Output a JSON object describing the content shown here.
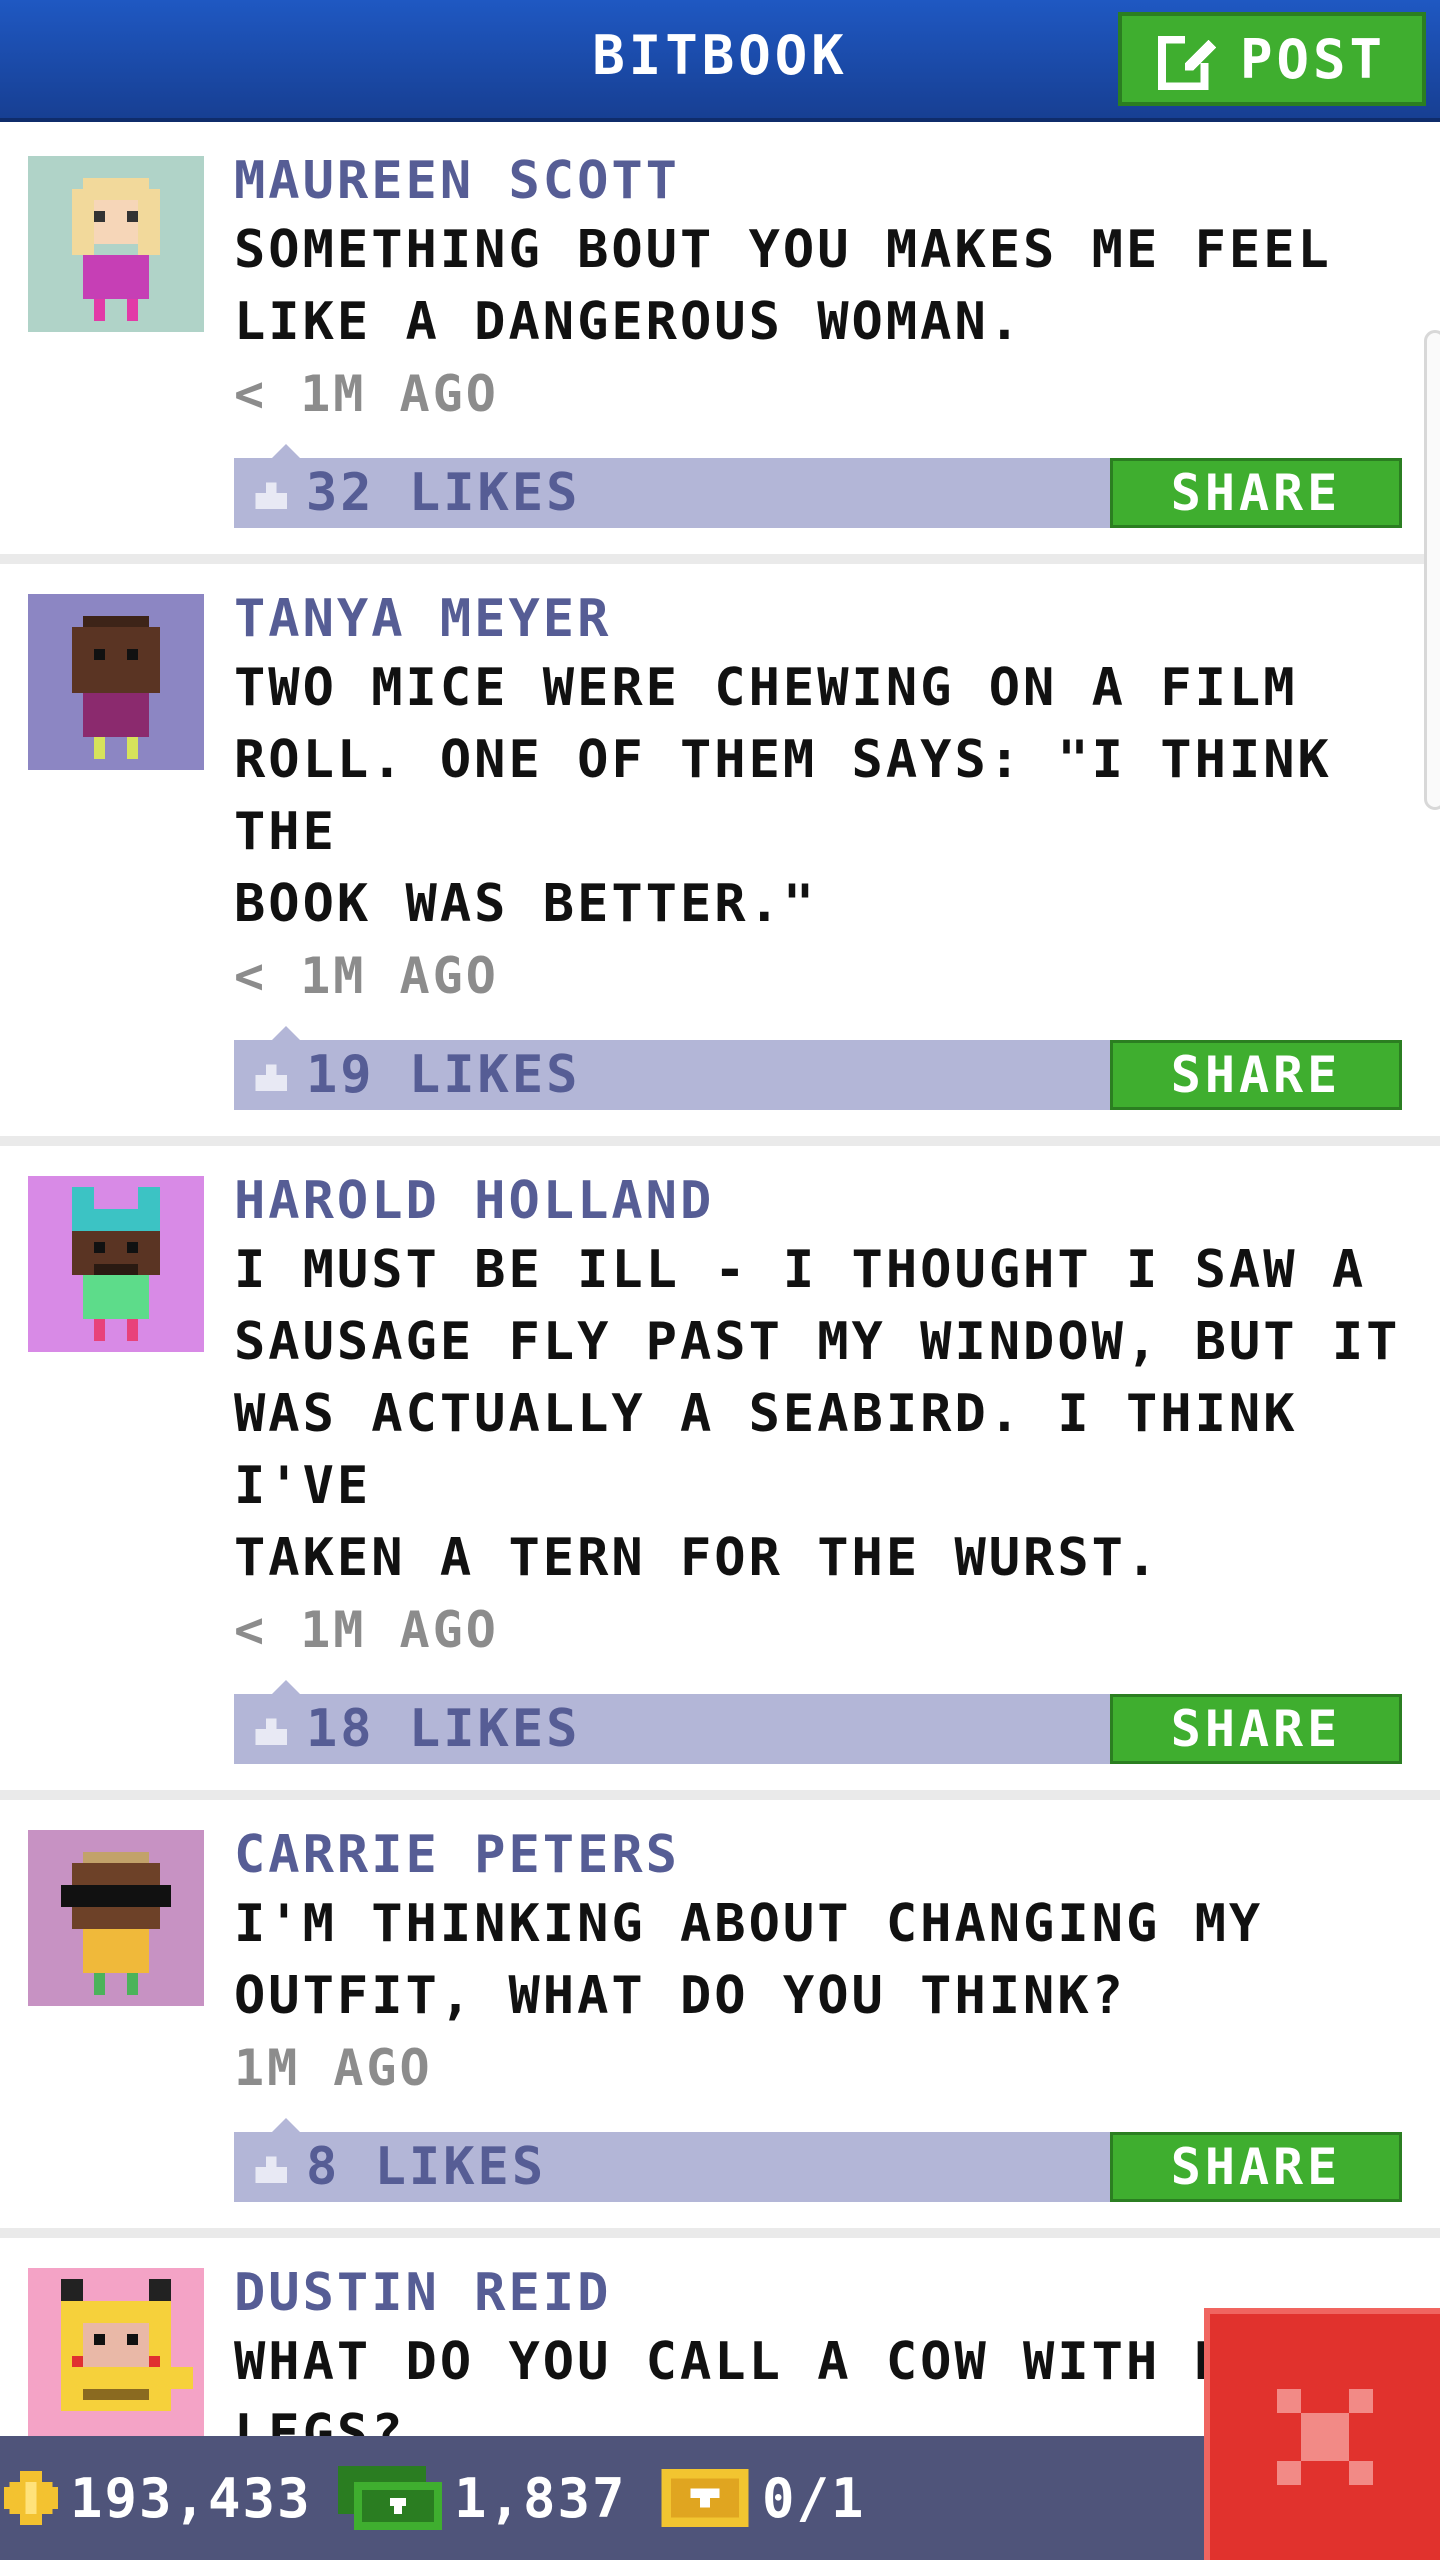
{
  "header": {
    "title": "BITBOOK",
    "post_label": "POST"
  },
  "colors": {
    "header_blue": "#1f58c2",
    "button_green": "#3fae2f",
    "likes_bar": "#b3b6d7",
    "name_purple": "#565d95",
    "close_red": "#e1322d"
  },
  "posts": [
    {
      "author": "MAUREEN SCOTT",
      "text": "SOMETHING BOUT YOU MAKES ME FEEL\nLIKE A DANGEROUS WOMAN.",
      "time": "< 1M AGO",
      "likes": "32 LIKES",
      "share_label": "SHARE",
      "avatar_icon": "avatar-blonde-woman-icon"
    },
    {
      "author": "TANYA MEYER",
      "text": "TWO MICE WERE CHEWING ON A FILM\nROLL. ONE OF THEM SAYS: \"I THINK THE\nBOOK WAS BETTER.\"",
      "time": "< 1M AGO",
      "likes": "19 LIKES",
      "share_label": "SHARE",
      "avatar_icon": "avatar-dark-skin-woman-icon"
    },
    {
      "author": "HAROLD HOLLAND",
      "text": "I MUST BE ILL - I THOUGHT I SAW A\nSAUSAGE FLY PAST MY WINDOW, BUT IT\nWAS ACTUALLY A SEABIRD. I THINK I'VE\nTAKEN A TERN FOR THE WURST.",
      "time": "< 1M AGO",
      "likes": "18 LIKES",
      "share_label": "SHARE",
      "avatar_icon": "avatar-man-with-headphones-icon"
    },
    {
      "author": "CARRIE PETERS",
      "text": "I'M THINKING ABOUT CHANGING MY\nOUTFIT, WHAT DO YOU THINK?",
      "time": "1M AGO",
      "likes": "8 LIKES",
      "share_label": "SHARE",
      "avatar_icon": "avatar-sunglasses-icon"
    },
    {
      "author": "DUSTIN REID",
      "text": "WHAT DO YOU CALL A COW WITH NO\nLEGS?\n\nGROUND BEEF",
      "avatar_icon": "avatar-yellow-costume-icon"
    }
  ],
  "bottom_bar": {
    "coins": "193,433",
    "cash": "1,837",
    "tickets": "0/1"
  }
}
